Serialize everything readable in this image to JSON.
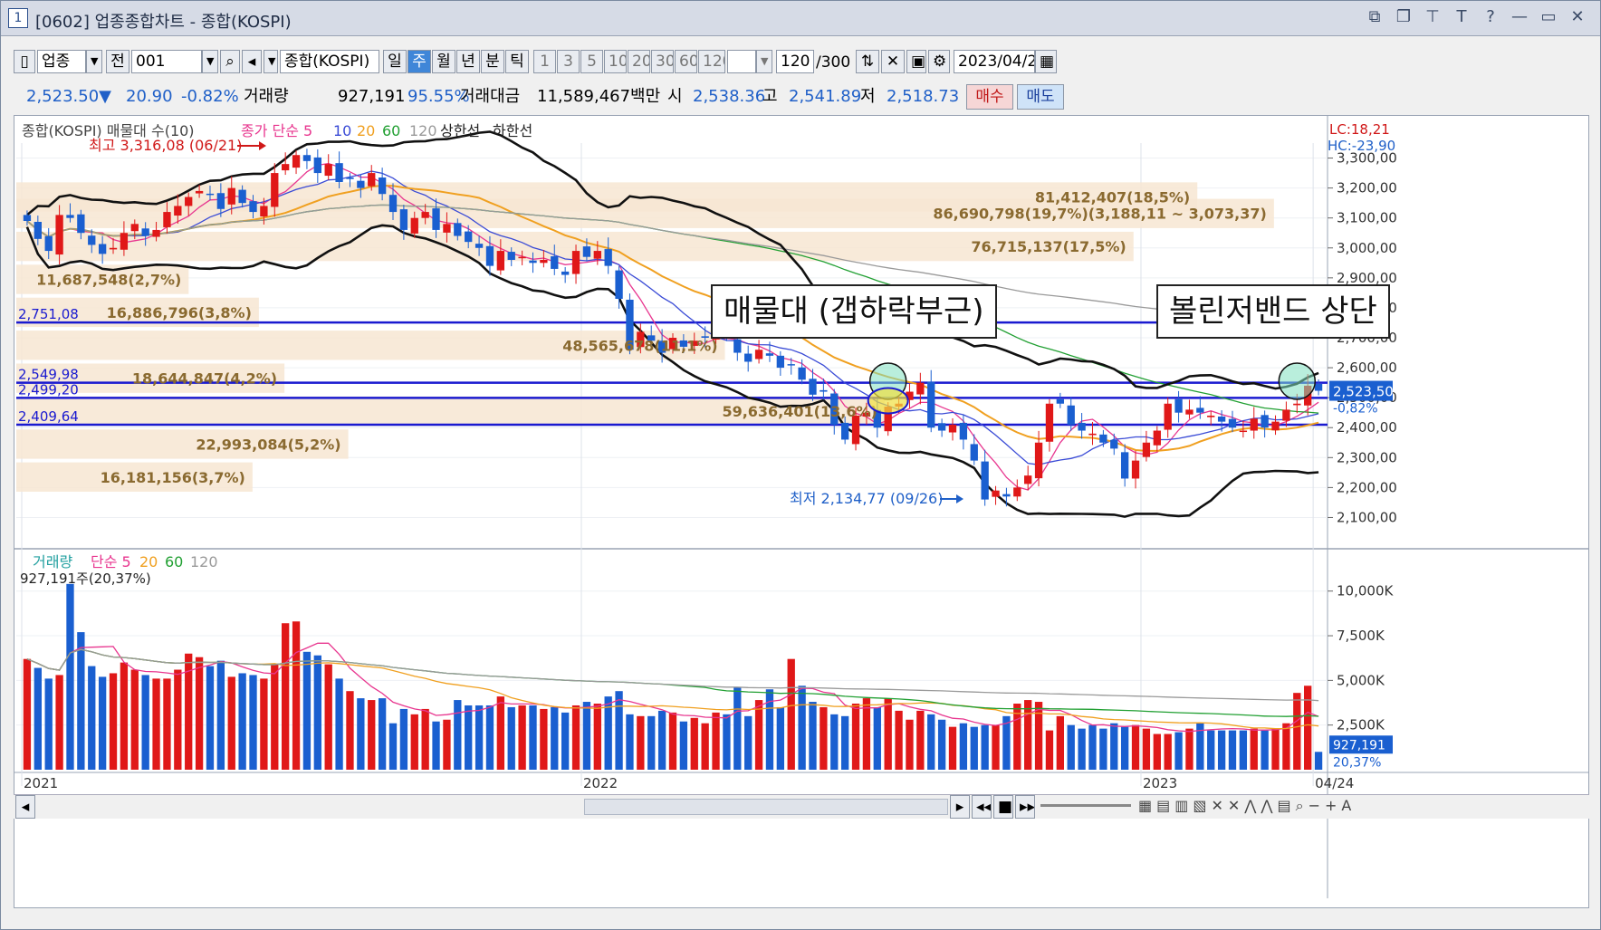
{
  "window": {
    "number": "1",
    "title": "[0602] 업종종합차트 - 종합(KOSPI)",
    "title_buttons": [
      "⧉",
      "❐",
      "⊤",
      "T",
      "?",
      "—",
      "▭",
      "✕"
    ]
  },
  "toolbar": {
    "market_type": "업종",
    "scope": "전",
    "code": "001",
    "index_name": "종합(KOSPI)",
    "periods": [
      "일",
      "주",
      "월",
      "년",
      "분",
      "틱"
    ],
    "selected_period": "주",
    "intervals": [
      "1",
      "3",
      "5",
      "10",
      "20",
      "30",
      "60",
      "120"
    ],
    "count": "120",
    "count_total": "/300",
    "date": "2023/04/24"
  },
  "quote": {
    "price": "2,523.50▼",
    "change": "20.90",
    "change_pct": "-0.82%",
    "volume_label": "거래량",
    "volume": "927,191",
    "volume_ratio": "95.55%",
    "amount_label": "거래대금",
    "amount": "11,589,467백만",
    "open_label": "시",
    "open": "2,538.36",
    "high_label": "고",
    "high": "2,541.89",
    "low_label": "저",
    "low": "2,518.73",
    "buy_label": "매수",
    "sell_label": "매도"
  },
  "legend": {
    "main": "종합(KOSPI) 매물대 수(10)",
    "ma_label": "종가 단순 5",
    "ma_periods": [
      "10",
      "20",
      "60",
      "120"
    ],
    "ma_colors": [
      "#e8368f",
      "#3a4bd6",
      "#f0a020",
      "#22a033",
      "#9a9a9a"
    ],
    "upper": "상한선",
    "lower": "하한선",
    "lc": "LC:18,21",
    "hc": "HC:-23,90",
    "volume_title": "거래량",
    "volume_ma": "단순 5",
    "volume_ma_periods": [
      "20",
      "60",
      "120"
    ],
    "volume_value": "927,191주(20,37%)"
  },
  "annotations": {
    "high_label": "최고 3,316,08 (06/21)",
    "low_label": "최저 2,134,77 (09/26)",
    "callout_left": "매물대 (갭하락부근)",
    "callout_right": "볼린저밴드 상단",
    "current_price_tag": "2,523,50",
    "current_change_tag": "-0,82%",
    "volume_tag": "927,191",
    "volume_pct_tag": "20,37%",
    "hlines": [
      {
        "label": "2,751,08",
        "value": 2751.08
      },
      {
        "label": "2,549,98",
        "value": 2549.98
      },
      {
        "label": "2,499,20",
        "value": 2499.2
      },
      {
        "label": "2,409,64",
        "value": 2409.64
      }
    ]
  },
  "volume_profile": [
    {
      "label": "81,412,407(18,5%)",
      "price": 3170,
      "pct": 18.5
    },
    {
      "label": "86,690,798(19,7%)(3,188,11 ~ 3,073,37)",
      "price": 3115,
      "pct": 19.7
    },
    {
      "label": "76,715,137(17,5%)",
      "price": 3005,
      "pct": 17.5
    },
    {
      "label": "11,687,548(2,7%)",
      "price": 2895,
      "pct": 2.7
    },
    {
      "label": "16,886,796(3,8%)",
      "price": 2785,
      "pct": 3.8
    },
    {
      "label": "48,565,678(11,1%)",
      "price": 2675,
      "pct": 11.1
    },
    {
      "label": "18,644,847(4,2%)",
      "price": 2565,
      "pct": 4.2
    },
    {
      "label": "59,636,401(13,6%)",
      "price": 2455,
      "pct": 13.6
    },
    {
      "label": "22,993,084(5,2%)",
      "price": 2345,
      "pct": 5.2
    },
    {
      "label": "16,181,156(3,7%)",
      "price": 2235,
      "pct": 3.7
    }
  ],
  "chart_data": {
    "type": "candlestick",
    "price_axis": {
      "min": 2050,
      "max": 3350,
      "ticks": [
        "3,300,00",
        "3,200,00",
        "3,100,00",
        "3,000,00",
        "2,900,00",
        "2,800,00",
        "2,700,00",
        "2,600,00",
        "2,500,00",
        "2,400,00",
        "2,300,00",
        "2,200,00",
        "2,100,00"
      ],
      "tick_values": [
        3300,
        3200,
        3100,
        3000,
        2900,
        2800,
        2700,
        2600,
        2500,
        2400,
        2300,
        2200,
        2100
      ]
    },
    "volume_axis": {
      "min": 0,
      "max": 11000,
      "ticks": [
        "10,000K",
        "7,500K",
        "5,000K",
        "2,500K"
      ],
      "tick_values": [
        10000,
        7500,
        5000,
        2500
      ]
    },
    "x_labels": [
      {
        "label": "2021",
        "index": 0
      },
      {
        "label": "2022",
        "index": 52
      },
      {
        "label": "2023",
        "index": 104
      },
      {
        "label": "04/24",
        "index": 120
      }
    ],
    "closes": [
      3090,
      3030,
      2990,
      3110,
      3100,
      3050,
      3010,
      2980,
      3000,
      3050,
      3080,
      3040,
      3060,
      3120,
      3140,
      3170,
      3190,
      3180,
      3130,
      3200,
      3150,
      3120,
      3140,
      3250,
      3280,
      3310,
      3290,
      3250,
      3280,
      3220,
      3230,
      3200,
      3250,
      3180,
      3120,
      3060,
      3100,
      3120,
      3060,
      3080,
      3040,
      3020,
      3000,
      2940,
      2990,
      2960,
      2970,
      2950,
      2960,
      2930,
      2910,
      2990,
      2970,
      2990,
      2940,
      2830,
      2660,
      2720,
      2690,
      2650,
      2700,
      2670,
      2690,
      2700,
      2720,
      2710,
      2650,
      2620,
      2660,
      2640,
      2600,
      2610,
      2560,
      2510,
      2520,
      2410,
      2360,
      2440,
      2450,
      2400,
      2470,
      2480,
      2520,
      2550,
      2400,
      2390,
      2410,
      2360,
      2290,
      2160,
      2190,
      2170,
      2200,
      2240,
      2350,
      2480,
      2480,
      2410,
      2390,
      2380,
      2350,
      2330,
      2230,
      2290,
      2350,
      2390,
      2480,
      2450,
      2460,
      2450,
      2440,
      2420,
      2400,
      2390,
      2430,
      2400,
      2420,
      2460,
      2480,
      2540,
      2523
    ],
    "volumes": [
      6200,
      5700,
      5100,
      5300,
      10400,
      7700,
      5800,
      5200,
      5400,
      6000,
      5600,
      5300,
      5100,
      5100,
      5600,
      6500,
      6300,
      5800,
      6100,
      5200,
      5400,
      5300,
      5100,
      5900,
      8200,
      8300,
      6600,
      6400,
      5900,
      5100,
      4400,
      4000,
      3900,
      4000,
      2600,
      3400,
      3100,
      3400,
      2700,
      2800,
      3900,
      3600,
      3600,
      3600,
      4100,
      3500,
      3600,
      3600,
      3400,
      3500,
      3200,
      3600,
      3800,
      3700,
      4100,
      4400,
      3100,
      3000,
      3000,
      3300,
      3200,
      2700,
      2900,
      2600,
      3200,
      3100,
      4600,
      3000,
      3900,
      4500,
      3500,
      6200,
      4700,
      3800,
      3500,
      3100,
      3000,
      3700,
      4000,
      3500,
      4000,
      3300,
      2800,
      3300,
      3100,
      2800,
      2400,
      2600,
      2400,
      2500,
      2500,
      3000,
      3700,
      3900,
      3800,
      2200,
      3000,
      2500,
      2300,
      2500,
      2300,
      2600,
      2400,
      2500,
      2300,
      2000,
      2000,
      2100,
      2300,
      2600,
      2200,
      2200,
      2200,
      2200,
      2300,
      2200,
      2300,
      2600,
      4300,
      4700,
      1000
    ]
  }
}
